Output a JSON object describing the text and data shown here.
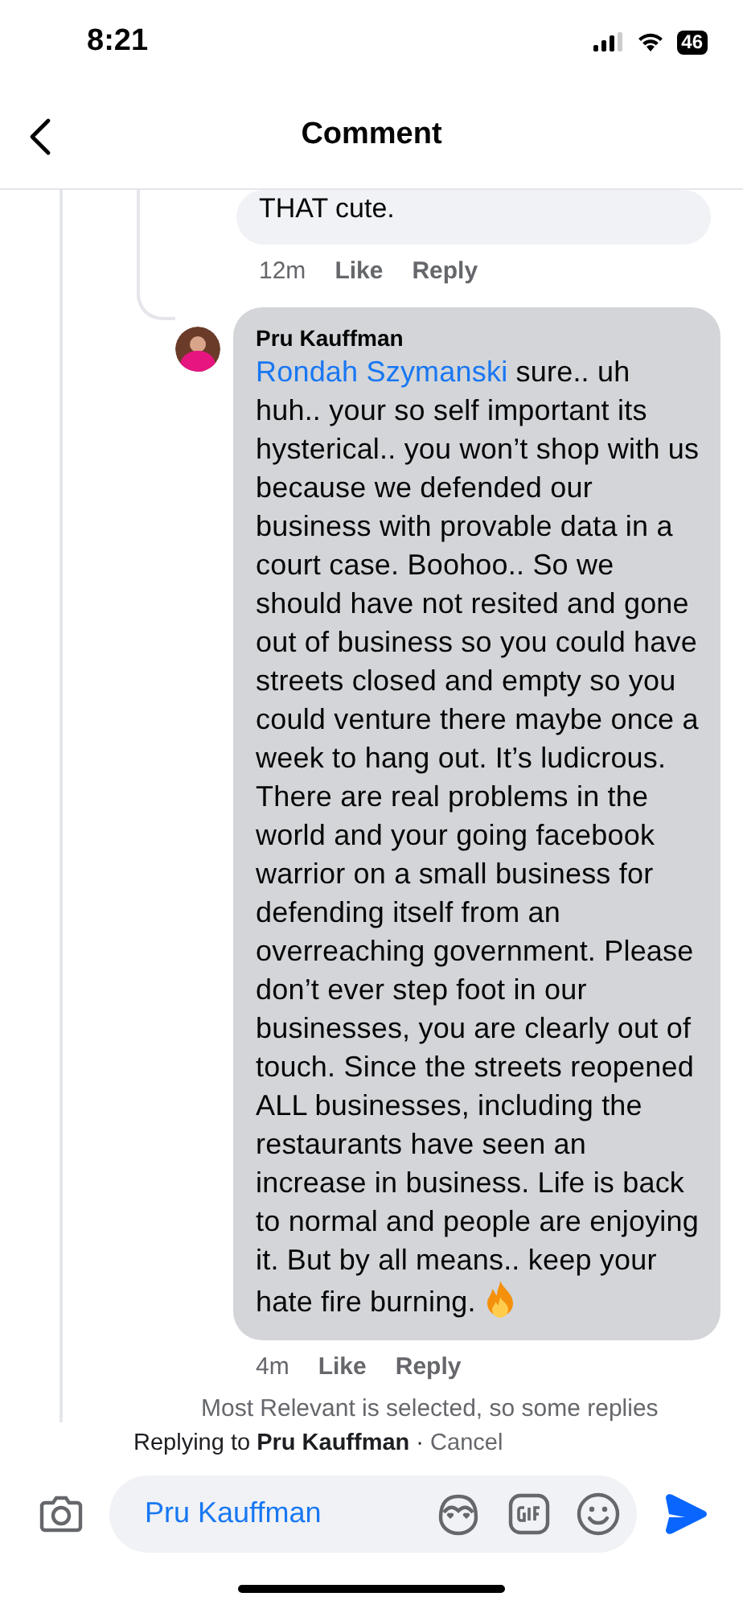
{
  "status_bar": {
    "time": "8:21",
    "battery": "46"
  },
  "header": {
    "title": "Comment"
  },
  "previous_comment": {
    "text": "THAT cute.",
    "time": "12m",
    "actions": [
      "Like",
      "Reply"
    ]
  },
  "reply": {
    "author": "Pru Kauffman",
    "mention": "Rondah Szymanski",
    "text": "sure.. uh huh.. your so self important its hysterical.. you won’t shop with us because we defended our business with provable data in a court case.  Boohoo.. So we should have not resited and gone out of business so you could have streets closed and empty so you could venture there maybe once a week to hang out.  It’s ludicrous.  There are real problems in the world and your going facebook warrior on a small business for defending itself from an overreaching government. Please don’t ever step foot in our businesses, you are clearly out of touch. Since the streets reopened ALL businesses, including the restaurants have seen an increase in business.  Life is back to normal and people are enjoying it. But by all means.. keep your hate fire burning.",
    "time": "4m",
    "actions": [
      "Like",
      "Reply"
    ]
  },
  "notice": "Most Relevant is selected, so some replies",
  "composer": {
    "replying_prefix": "Replying to",
    "replying_to": "Pru Kauffman",
    "separator": "·",
    "cancel": "Cancel",
    "value": "Pru Kauffman"
  }
}
